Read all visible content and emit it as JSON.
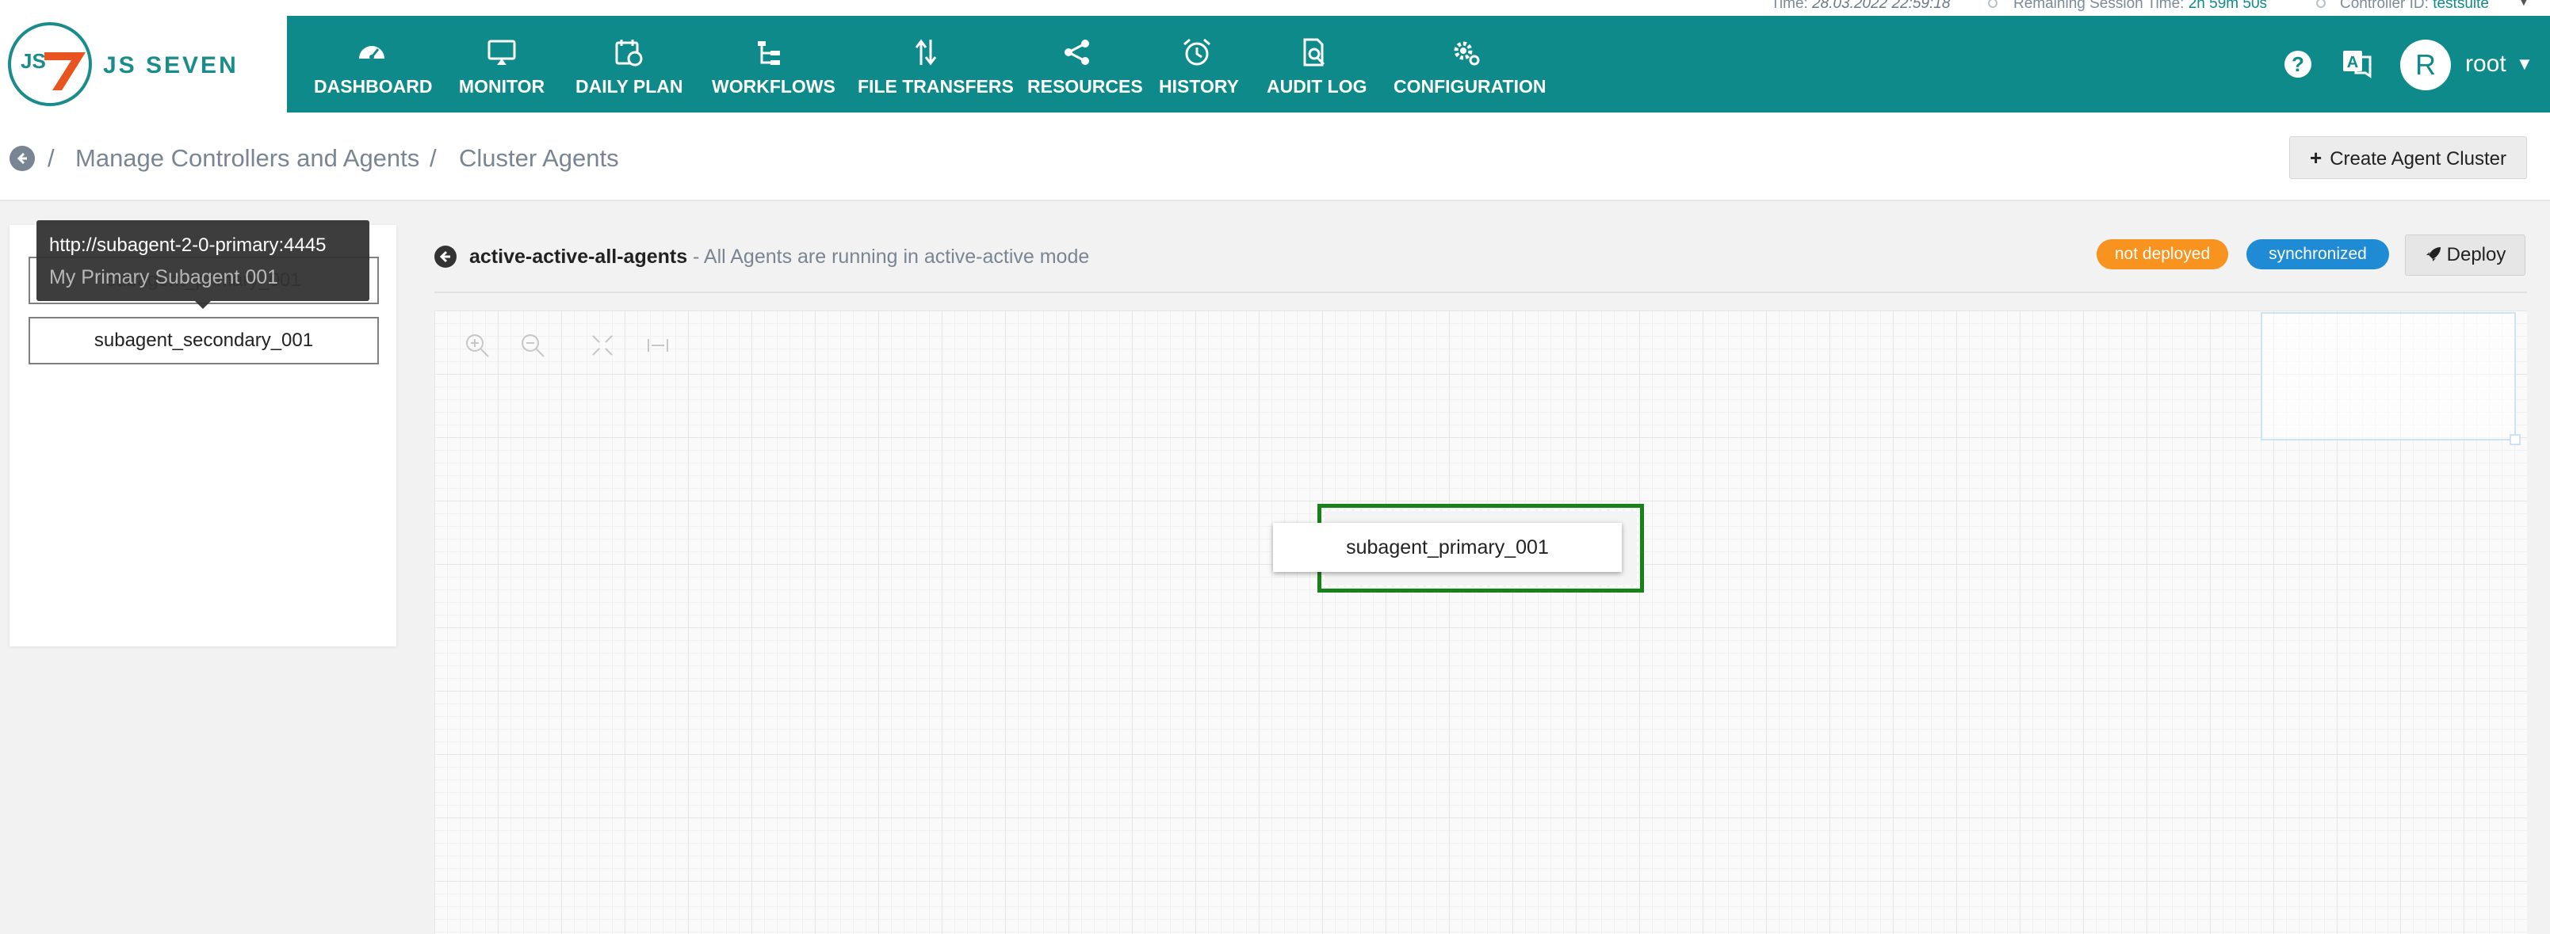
{
  "status_bar": {
    "time_label": "Time:",
    "time_value": "28.03.2022 22:59:18",
    "session_label": "Remaining Session Time:",
    "session_value": "2h 59m 50s",
    "controller_label": "Controller ID:",
    "controller_value": "testsuite"
  },
  "logo": {
    "badge_text": "JS",
    "brand_text": "JS SEVEN"
  },
  "nav": {
    "items": [
      {
        "label": "DASHBOARD",
        "icon": "dashboard-gauge-icon"
      },
      {
        "label": "MONITOR",
        "icon": "monitor-icon"
      },
      {
        "label": "DAILY PLAN",
        "icon": "calendar-clock-icon"
      },
      {
        "label": "WORKFLOWS",
        "icon": "workflow-tree-icon"
      },
      {
        "label": "FILE TRANSFERS",
        "icon": "transfer-arrows-icon"
      },
      {
        "label": "RESOURCES",
        "icon": "share-nodes-icon"
      },
      {
        "label": "HISTORY",
        "icon": "alarm-clock-icon"
      },
      {
        "label": "AUDIT LOG",
        "icon": "document-search-icon"
      },
      {
        "label": "CONFIGURATION",
        "icon": "gears-icon"
      }
    ]
  },
  "header_right": {
    "help": "?",
    "lang": "A",
    "avatar_initial": "R",
    "user": "root"
  },
  "breadcrumb": {
    "sep": "/",
    "items": [
      "Manage Controllers and Agents",
      "Cluster Agents"
    ]
  },
  "actions": {
    "create_cluster": "Create Agent Cluster"
  },
  "left_panel": {
    "subagents": [
      "subagent_primary_001",
      "subagent_secondary_001"
    ],
    "tooltip": {
      "url": "http://subagent-2-0-primary:4445",
      "title": "My Primary Subagent 001"
    }
  },
  "cluster": {
    "name": "active-active-all-agents",
    "description": "- All Agents are running in active-active mode",
    "badges": {
      "deploy_state": "not deployed",
      "sync_state": "synchronized"
    },
    "deploy_label": "Deploy"
  },
  "canvas": {
    "node_label": "subagent_primary_001"
  },
  "colors": {
    "header": "#0e8a8a",
    "not_deployed": "#f7931e",
    "synchronized": "#1e8bd4",
    "node_border": "#178217"
  }
}
